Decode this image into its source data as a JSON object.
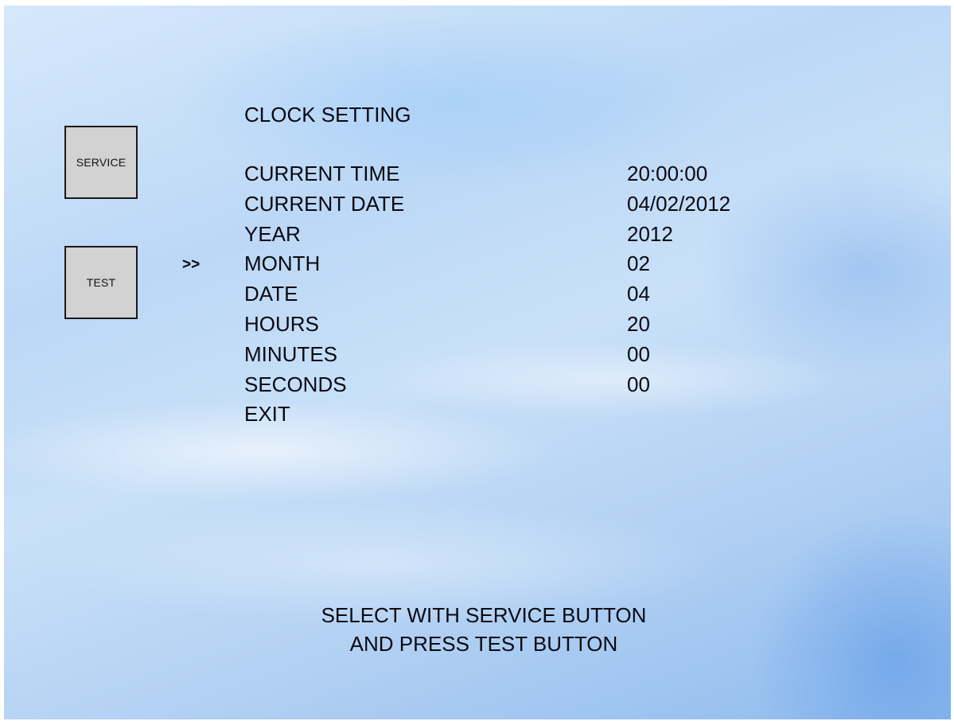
{
  "side_buttons": {
    "service_label": "SERVICE",
    "test_label": "TEST"
  },
  "screen": {
    "title": "CLOCK SETTING",
    "cursor": ">>",
    "selected_index": 3,
    "items": [
      {
        "label": "CURRENT TIME",
        "value": "20:00:00"
      },
      {
        "label": "CURRENT DATE",
        "value": "04/02/2012"
      },
      {
        "label": "YEAR",
        "value": "2012"
      },
      {
        "label": "MONTH",
        "value": "02"
      },
      {
        "label": "DATE",
        "value": "04"
      },
      {
        "label": "HOURS",
        "value": "20"
      },
      {
        "label": "MINUTES",
        "value": "00"
      },
      {
        "label": "SECONDS",
        "value": "00"
      },
      {
        "label": "EXIT",
        "value": ""
      }
    ],
    "instructions": {
      "line1": "SELECT WITH SERVICE BUTTON",
      "line2": "AND PRESS TEST BUTTON"
    }
  }
}
